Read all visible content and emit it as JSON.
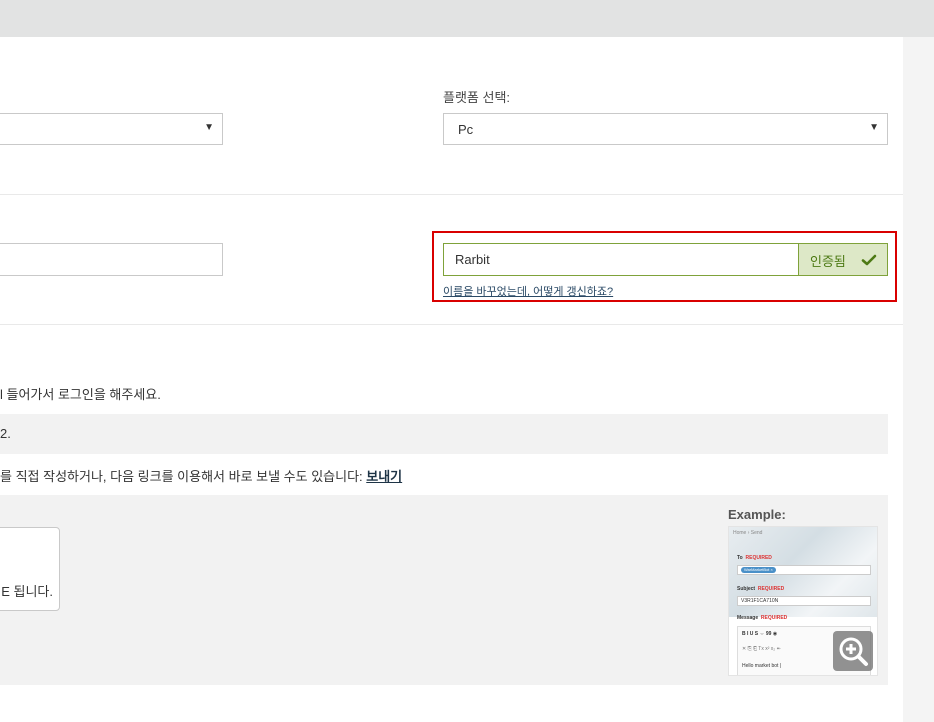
{
  "platform": {
    "label": "플랫폼 선택:",
    "selected": "Pc",
    "left_select_value": ""
  },
  "verification": {
    "name_value": "Rarbit",
    "status": "인증됨",
    "rename_link": "이름을 바꾸었는데, 어떻게 갱신하죠?"
  },
  "instructions": {
    "line1": "l 들어가서 로그인을 해주세요.",
    "line2": "2.",
    "line3_text": "를 직접 작성하거나, 다음 링크를 이용해서 바로 보낼 수도 있습니다: ",
    "line3_link": "보내기",
    "card_text": "E 됩니다."
  },
  "example": {
    "title": "Example:",
    "crumb": "Home › Send",
    "to_label": "To",
    "required": "REQUIRED",
    "to_tag": "WarMarketBot ×",
    "subject_label": "Subject",
    "subject_value": "V3R1F1CA710N",
    "message_label": "Message",
    "message_text": "Hello market bot |",
    "toolbar_row1": "B   I   U   S   ⇔   99   ◉",
    "toolbar_row2": "✕   ⎘   ⎗   Tx   x²   x₂   ↞"
  },
  "colors": {
    "verified_bg": "#dde8c7",
    "verified_text": "#4d7a14",
    "highlight_border": "#d90000"
  },
  "icons": {
    "check": "check-icon",
    "zoom": "zoom-in-icon",
    "dropdown": "caret-down-icon"
  }
}
